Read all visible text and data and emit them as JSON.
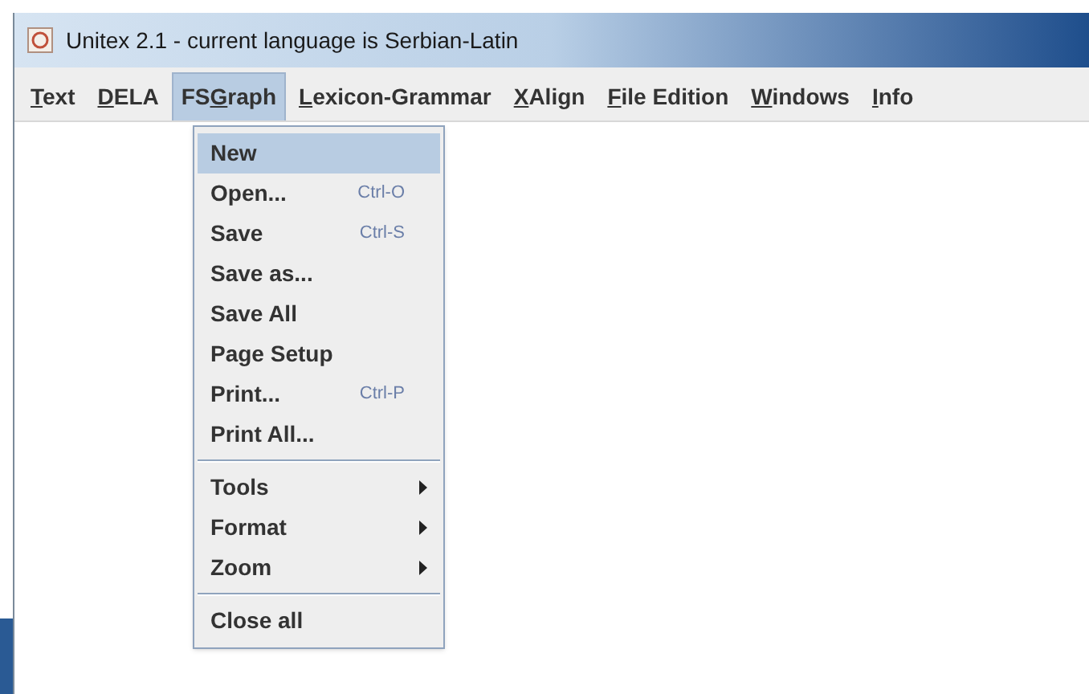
{
  "window": {
    "title": "Unitex 2.1 - current language is Serbian-Latin"
  },
  "menubar": [
    {
      "key": "T",
      "after": "ext",
      "selected": false
    },
    {
      "key": "D",
      "after": "ELA",
      "selected": false
    },
    {
      "before": "FS",
      "key": "G",
      "after": "raph",
      "selected": true
    },
    {
      "key": "L",
      "after": "exicon-Grammar",
      "selected": false
    },
    {
      "key": "X",
      "after": "Align",
      "selected": false
    },
    {
      "key": "F",
      "after": "ile Edition",
      "selected": false
    },
    {
      "key": "W",
      "after": "indows",
      "selected": false
    },
    {
      "key": "I",
      "after": "nfo",
      "selected": false
    }
  ],
  "menu": [
    {
      "kind": "item",
      "label": "New",
      "selected": true
    },
    {
      "kind": "item",
      "label": "Open...",
      "shortcut": "Ctrl-O",
      "selected": false
    },
    {
      "kind": "item",
      "label": "Save",
      "shortcut": "Ctrl-S",
      "selected": false
    },
    {
      "kind": "item",
      "label": "Save as...",
      "selected": false
    },
    {
      "kind": "item",
      "label": "Save All",
      "selected": false
    },
    {
      "kind": "item",
      "label": "Page Setup",
      "selected": false
    },
    {
      "kind": "item",
      "label": "Print...",
      "shortcut": "Ctrl-P",
      "selected": false
    },
    {
      "kind": "item",
      "label": "Print All...",
      "selected": false
    },
    {
      "kind": "separator"
    },
    {
      "kind": "submenu",
      "label": "Tools",
      "selected": false
    },
    {
      "kind": "submenu",
      "label": "Format",
      "selected": false
    },
    {
      "kind": "submenu",
      "label": "Zoom",
      "selected": false
    },
    {
      "kind": "separator"
    },
    {
      "kind": "item",
      "label": "Close all",
      "selected": false
    }
  ]
}
